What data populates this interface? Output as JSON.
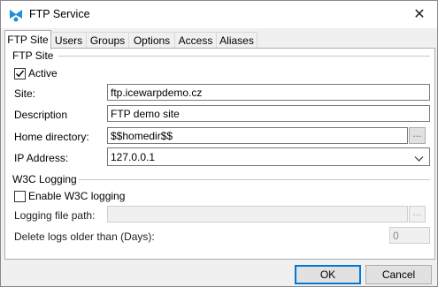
{
  "window": {
    "title": "FTP Service",
    "close_symbol": "✕"
  },
  "tabs": [
    {
      "label": "FTP Site",
      "active": true
    },
    {
      "label": "Users",
      "active": false
    },
    {
      "label": "Groups",
      "active": false
    },
    {
      "label": "Options",
      "active": false
    },
    {
      "label": "Access",
      "active": false
    },
    {
      "label": "Aliases",
      "active": false
    }
  ],
  "ftp_site": {
    "group_title": "FTP Site",
    "active_label": "Active",
    "active_checked": true,
    "site_label": "Site:",
    "site_value": "ftp.icewarpdemo.cz",
    "description_label": "Description",
    "description_value": "FTP demo site",
    "home_label": "Home directory:",
    "home_value": "$$homedir$$",
    "ip_label": "IP Address:",
    "ip_value": "127.0.0.1"
  },
  "w3c": {
    "group_title": "W3C Logging",
    "enable_label": "Enable W3C logging",
    "enable_checked": false,
    "path_label": "Logging file path:",
    "path_value": "",
    "delete_label": "Delete logs older than (Days):",
    "delete_value": "0"
  },
  "buttons": {
    "ok": "OK",
    "cancel": "Cancel",
    "browse": "..."
  },
  "colors": {
    "accent": "#0078d7",
    "icon": "#1e90d6"
  }
}
